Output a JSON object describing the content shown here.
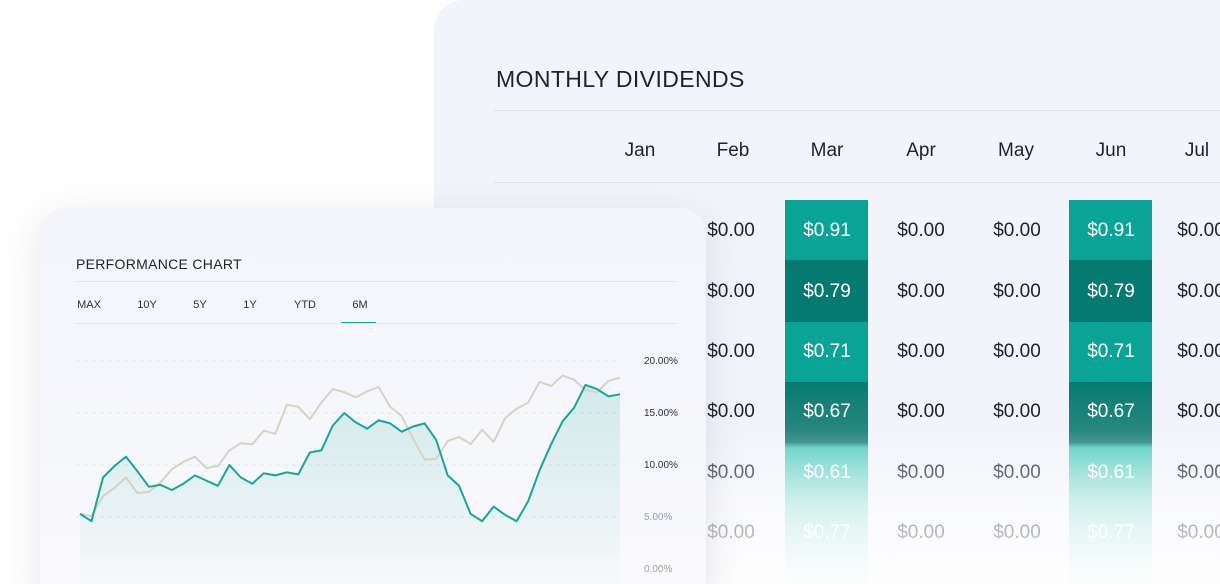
{
  "dividends": {
    "title": "MONTHLY DIVIDENDS",
    "months": [
      "Jan",
      "Feb",
      "Mar",
      "Apr",
      "May",
      "Jun",
      "Jul"
    ],
    "rows": [
      [
        "$0.00",
        "$0.91",
        "$0.00",
        "$0.00",
        "$0.91",
        "$0.00"
      ],
      [
        "$0.00",
        "$0.79",
        "$0.00",
        "$0.00",
        "$0.79",
        "$0.00"
      ],
      [
        "$0.00",
        "$0.71",
        "$0.00",
        "$0.00",
        "$0.71",
        "$0.00"
      ],
      [
        "$0.00",
        "$0.67",
        "$0.00",
        "$0.00",
        "$0.67",
        "$0.00"
      ],
      [
        "$0.00",
        "$0.61",
        "$0.00",
        "$0.00",
        "$0.61",
        "$0.00"
      ],
      [
        "$0.00",
        "$0.77",
        "$0.00",
        "$0.00",
        "$0.77",
        "$0.00"
      ]
    ],
    "colors": {
      "teal": "#0aa497",
      "teal_dark": "#067a70",
      "teal_light": "#5ccfc3"
    }
  },
  "performance": {
    "title": "PERFORMANCE CHART",
    "ranges": [
      "MAX",
      "10Y",
      "5Y",
      "1Y",
      "YTD",
      "6M"
    ],
    "selected_range": "6M",
    "accent": "#19a597",
    "benchmark_color": "#d8d2c6"
  },
  "chart_data": {
    "type": "line",
    "title": "",
    "xlabel": "",
    "ylabel": "",
    "ylim": [
      0,
      20
    ],
    "y_ticks": [
      "20.00%",
      "15.00%",
      "10.00%",
      "5.00%",
      "0.00%"
    ],
    "grid": true,
    "series": [
      {
        "values": [
          5.3,
          4.6,
          8.8,
          9.9,
          10.8,
          9.4,
          7.9,
          8.1,
          7.6,
          8.2,
          9.0,
          8.5,
          8.0,
          10.0,
          8.8,
          8.2,
          9.2,
          9.0,
          9.3,
          9.1,
          11.2,
          11.4,
          13.8,
          15.0,
          14.1,
          13.5,
          14.3,
          14.0,
          13.2,
          13.7,
          14.0,
          12.4,
          9.0,
          8.0,
          5.3,
          4.6,
          6.0,
          5.2,
          4.6,
          6.5,
          9.5,
          12.0,
          14.2,
          15.5,
          17.7,
          17.3,
          16.6,
          16.8
        ]
      },
      {
        "values": [
          5.3,
          5.1,
          7.0,
          7.8,
          8.8,
          7.3,
          7.4,
          8.3,
          9.6,
          10.3,
          10.8,
          9.7,
          9.9,
          11.4,
          12.1,
          12.0,
          13.3,
          13.0,
          15.8,
          15.6,
          14.4,
          16.0,
          17.3,
          17.0,
          16.5,
          17.1,
          17.5,
          15.6,
          14.7,
          12.5,
          10.5,
          10.6,
          12.3,
          12.7,
          12.0,
          13.4,
          12.2,
          14.5,
          15.4,
          16.0,
          18.0,
          17.6,
          18.6,
          18.2,
          17.2,
          17.0,
          18.1,
          18.4
        ]
      }
    ]
  }
}
